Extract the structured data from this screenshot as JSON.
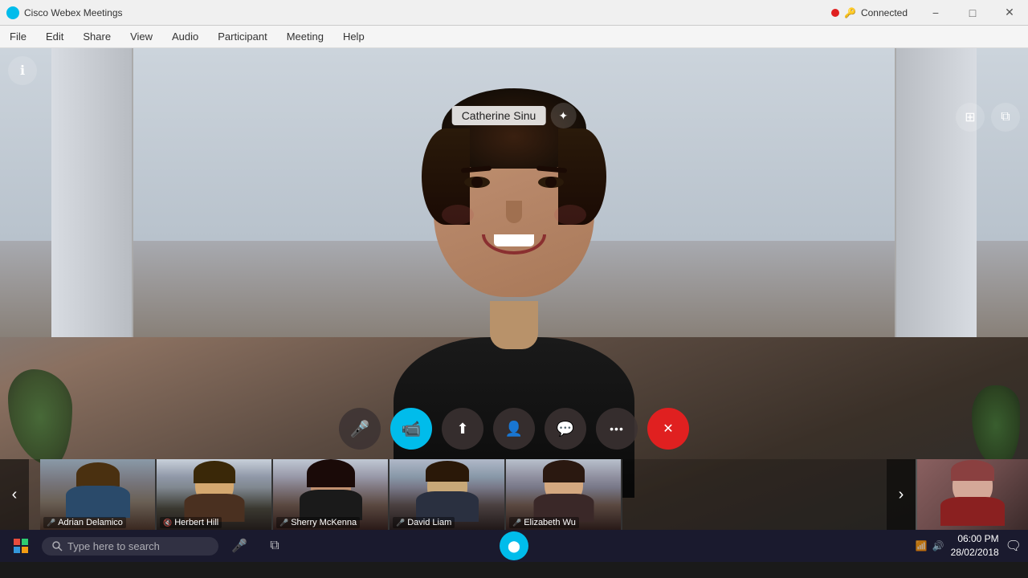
{
  "app": {
    "title": "Cisco Webex Meetings",
    "icon_color": "#00bceb"
  },
  "titlebar": {
    "title": "Cisco Webex Meetings",
    "minimize_label": "−",
    "maximize_label": "□",
    "close_label": "✕"
  },
  "menubar": {
    "items": [
      "File",
      "Edit",
      "Share",
      "View",
      "Audio",
      "Participant",
      "Meeting",
      "Help"
    ]
  },
  "connection": {
    "status": "Connected",
    "dot_color": "#e02020"
  },
  "speaker": {
    "name": "Catherine Sinu"
  },
  "controls": {
    "mute_label": "🎤",
    "video_label": "📹",
    "share_label": "⬆",
    "participants_label": "👤",
    "chat_label": "💬",
    "more_label": "•••",
    "end_label": "✕"
  },
  "thumbnails": [
    {
      "name": "Adrian Delamico",
      "muted": false,
      "bg": "#6a8070"
    },
    {
      "name": "Herbert Hill",
      "muted": true,
      "bg": "#7a8090"
    },
    {
      "name": "Sherry McKenna",
      "muted": false,
      "bg": "#8a7080"
    },
    {
      "name": "David Liam",
      "muted": false,
      "bg": "#7a8890"
    },
    {
      "name": "Elizabeth Wu",
      "muted": false,
      "bg": "#9a8878"
    }
  ],
  "taskbar": {
    "search_placeholder": "Type here to search",
    "time": "06:00 PM",
    "date": "28/02/2018"
  }
}
